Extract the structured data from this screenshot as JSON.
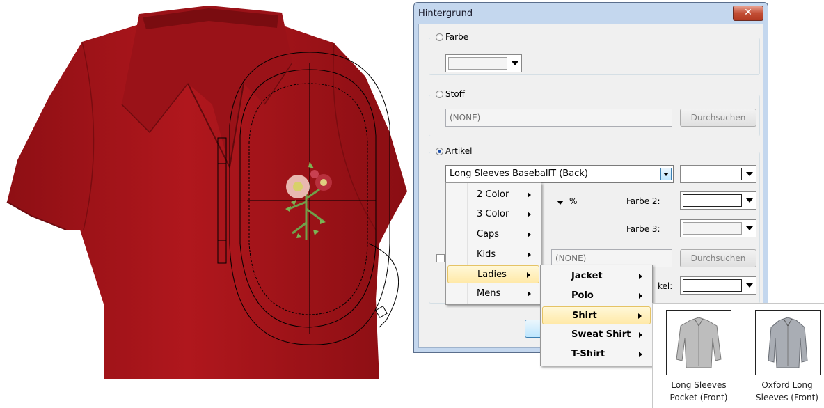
{
  "dialog": {
    "title": "Hintergrund",
    "close_label": "✕",
    "farbe_label": "Farbe",
    "stoff_label": "Stoff",
    "stoff_value": "(NONE)",
    "stoff_browse": "Durchsuchen",
    "artikel_label": "Artikel",
    "artikel_value": "Long Sleeves BaseballT (Back)",
    "percent_label": "%",
    "farbe2_label": "Farbe 2:",
    "farbe3_label": "Farbe 3:",
    "hidden_field_value": "(NONE)",
    "hidden_browse": "Durchsuchen",
    "artikel_color_label": "kel:"
  },
  "menu_main": {
    "items": [
      "2 Color",
      "3 Color",
      "Caps",
      "Kids",
      "Ladies",
      "Mens"
    ],
    "highlighted": "Ladies"
  },
  "menu_sub": {
    "items": [
      "Jacket",
      "Polo",
      "Shirt",
      "Sweat Shirt",
      "T-Shirt"
    ],
    "highlighted": "Shirt"
  },
  "thumbnails": [
    {
      "caption_line1": "Long Sleeves",
      "caption_line2": "Pocket (Front)",
      "icon": "shirt-icon"
    },
    {
      "caption_line1": "Oxford Long",
      "caption_line2": "Sleeves (Front)",
      "icon": "shirt-icon"
    }
  ],
  "colors": {
    "garment": "#a8141a",
    "highlight": "#ffe9a8",
    "dialog_frame": "#c4d7ee"
  }
}
